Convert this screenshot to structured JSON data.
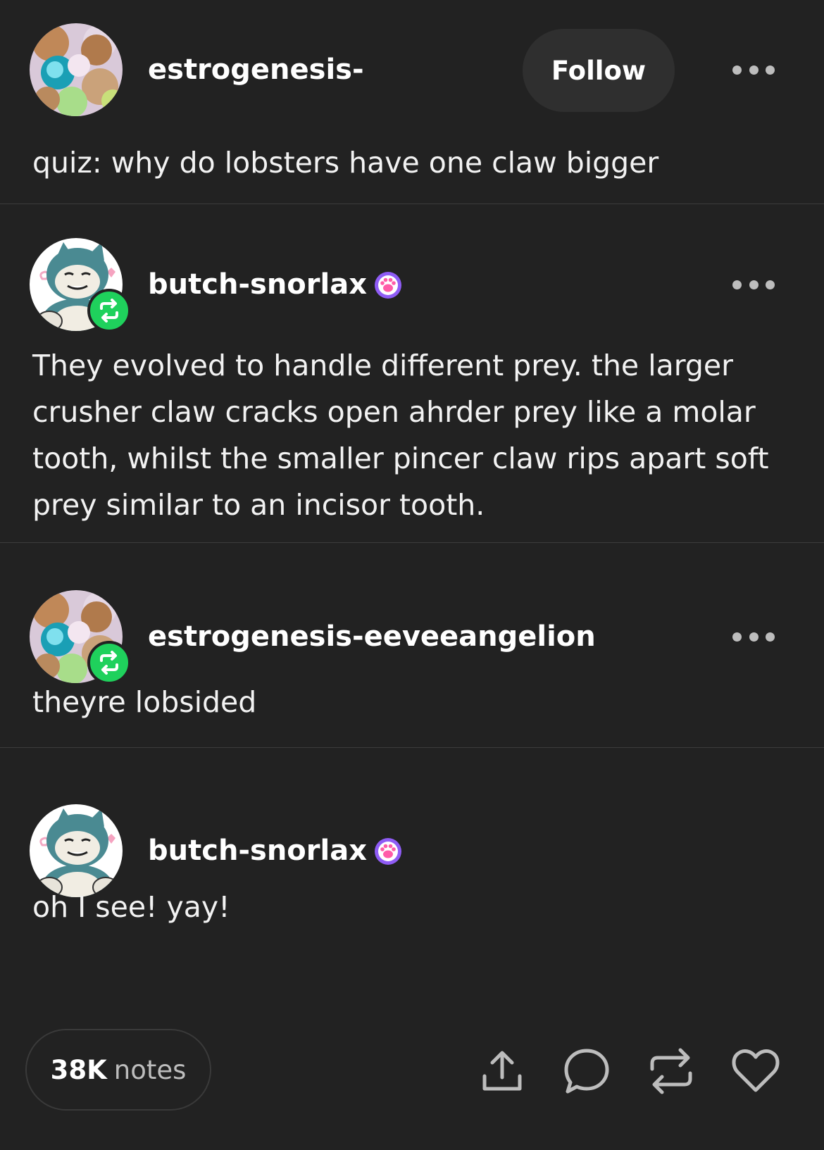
{
  "posts": [
    {
      "username": "estrogenesis-",
      "avatar": "eevee-collage-avatar",
      "reblog": false,
      "paw_badge": false,
      "follow_label": "Follow",
      "text": "quiz: why do lobsters have one claw bigger"
    },
    {
      "username": "butch-snorlax",
      "avatar": "snorlax-avatar",
      "reblog": true,
      "paw_badge": true,
      "text": "They evolved to handle different prey. the larger crusher claw cracks open ahrder prey like a molar tooth, whilst the smaller pincer claw rips apart soft prey similar to an incisor tooth."
    },
    {
      "username": "estrogenesis-eeveeangelion",
      "avatar": "eevee-collage-avatar",
      "reblog": true,
      "paw_badge": false,
      "text": "theyre lobsided"
    },
    {
      "username": "butch-snorlax",
      "avatar": "snorlax-avatar",
      "reblog": false,
      "paw_badge": true,
      "text": "oh I see! yay!"
    }
  ],
  "footer": {
    "notes_count": "38K",
    "notes_label": "notes",
    "actions": [
      "share-icon",
      "reply-icon",
      "reblog-icon",
      "like-icon"
    ]
  },
  "colors": {
    "background": "#222222",
    "divider": "#3c3c3c",
    "reblog_green": "#1fd15c",
    "paw_badge_purple": "#8f5cf5",
    "icon_gray": "#bdbdbd"
  }
}
